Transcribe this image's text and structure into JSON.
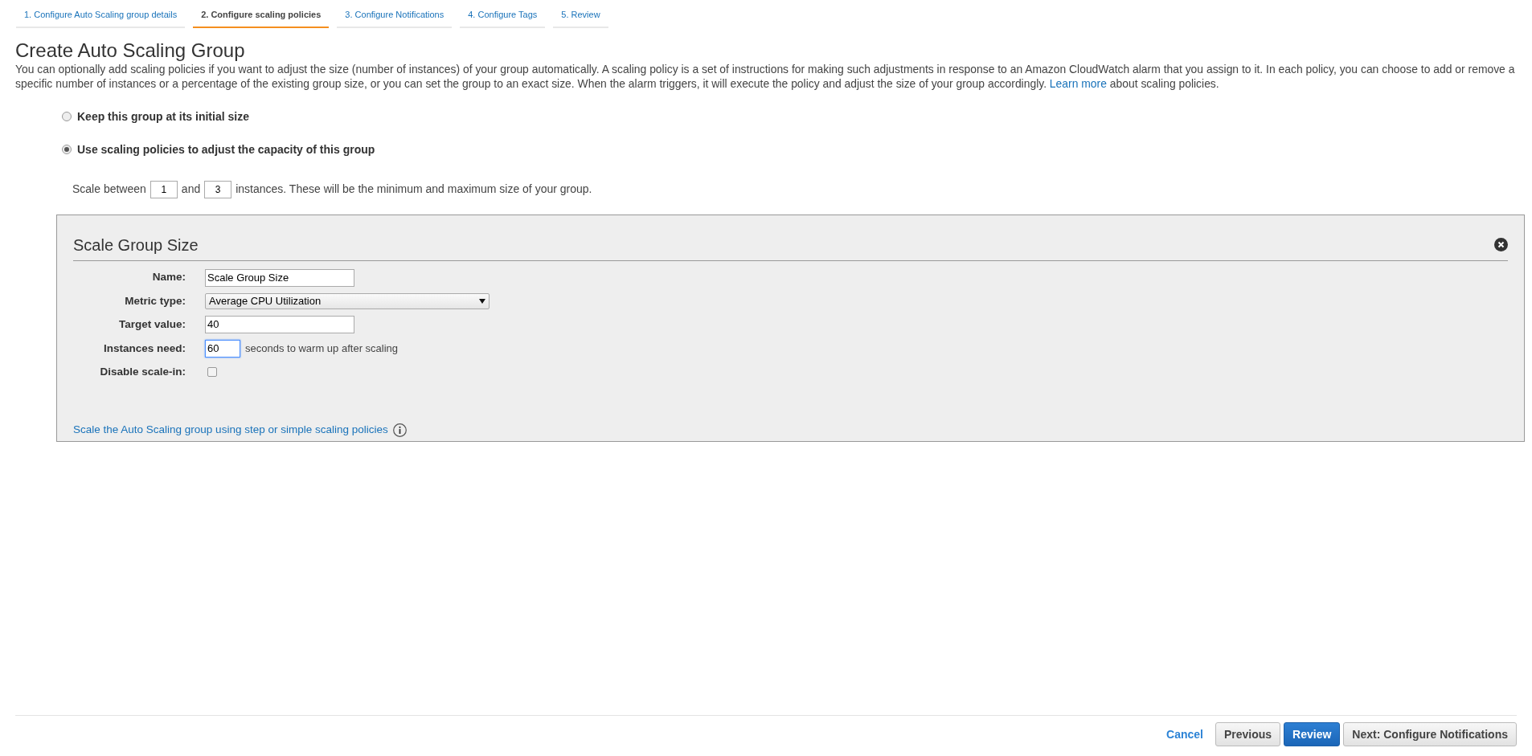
{
  "steps": [
    {
      "label": "1. Configure Auto Scaling group details",
      "selected": false
    },
    {
      "label": "2. Configure scaling policies",
      "selected": true
    },
    {
      "label": "3. Configure Notifications",
      "selected": false
    },
    {
      "label": "4. Configure Tags",
      "selected": false
    },
    {
      "label": "5. Review",
      "selected": false
    }
  ],
  "title": "Create Auto Scaling Group",
  "description": {
    "before": "You can optionally add scaling policies if you want to adjust the size (number of instances) of your group automatically. A scaling policy is a set of instructions for making such adjustments in response to an Amazon CloudWatch alarm that you assign to it. In each policy, you can choose to add or remove a specific number of instances or a percentage of the existing group size, or you can set the group to an exact size. When the alarm triggers, it will execute the policy and adjust the size of your group accordingly.",
    "link": "Learn more",
    "after": "about scaling policies."
  },
  "options": [
    {
      "label": "Keep this group at its initial size",
      "selected": false
    },
    {
      "label": "Use scaling policies to adjust the capacity of this group",
      "selected": true
    }
  ],
  "scale_range": {
    "prefix": "Scale between",
    "min": "1",
    "middle": "and",
    "max": "3",
    "suffix": "instances. These will be the minimum and maximum size of your group."
  },
  "policy": {
    "title": "Scale Group Size",
    "fields": [
      {
        "kind": "text",
        "label": "Name:",
        "value": "Scale Group Size"
      },
      {
        "kind": "select",
        "label": "Metric type:",
        "value": "Average CPU Utilization"
      },
      {
        "kind": "text",
        "label": "Target value:",
        "value": "40"
      },
      {
        "kind": "short",
        "label": "Instances need:",
        "value": "60",
        "focused": true,
        "suffix": "seconds to warm up after scaling"
      },
      {
        "kind": "checkbox",
        "label": "Disable scale-in:",
        "checked": false
      }
    ],
    "link": "Scale the Auto Scaling group using step or simple scaling policies"
  },
  "buttons": [
    {
      "kind": "link",
      "label": "Cancel"
    },
    {
      "kind": "default",
      "label": "Previous"
    },
    {
      "kind": "primary",
      "label": "Review"
    },
    {
      "kind": "default",
      "label": "Next: Configure Notifications"
    }
  ]
}
